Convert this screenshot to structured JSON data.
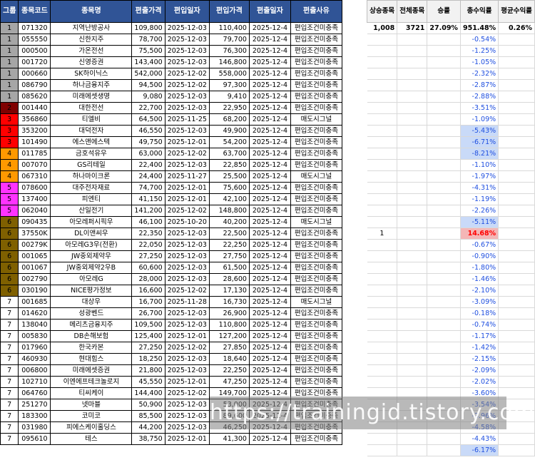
{
  "headers": {
    "group": "그룹",
    "code": "종목코드",
    "name": "종목명",
    "in_price": "편출가격",
    "in_date": "편입일자",
    "buy_price": "편입가격",
    "out_date": "편출일자",
    "reason": "편출사유"
  },
  "stats_headers": {
    "up": "상승종목",
    "total": "전체종목",
    "winrate": "승률",
    "total_return": "총수익률",
    "avg_return": "평균수익률"
  },
  "stats_values": {
    "up": "1,008",
    "total": "3721",
    "winrate": "27.09%",
    "total_return": "951.48%",
    "avg_return": "0.26%"
  },
  "group_colors": {
    "1": "#a6a6a6",
    "2": "#7f0000",
    "3": "#ff0000",
    "4": "#ff9900",
    "5": "#ff33ff",
    "6": "#7f6000",
    "7": "#ffffff"
  },
  "return_colors": {
    "neg": "#1f4fe0",
    "pos": "#ff0000",
    "highlight_blue": "#c9daf8",
    "highlight_red": "#f4b6b6"
  },
  "rows": [
    {
      "group": "1",
      "code": "071320",
      "name": "지역난방공사",
      "in_price": "109,800",
      "in_date": "2025-12-03",
      "buy_price": "110,400",
      "out_date": "2025-12-4",
      "reason": "편입조건미충족",
      "up": "",
      "ret": "-0.54%",
      "hl": ""
    },
    {
      "group": "1",
      "code": "055550",
      "name": "신한지주",
      "in_price": "78,700",
      "in_date": "2025-12-03",
      "buy_price": "79,700",
      "out_date": "2025-12-4",
      "reason": "편입조건미충족",
      "up": "",
      "ret": "-1.25%",
      "hl": ""
    },
    {
      "group": "1",
      "code": "000500",
      "name": "가온전선",
      "in_price": "75,500",
      "in_date": "2025-12-03",
      "buy_price": "76,300",
      "out_date": "2025-12-4",
      "reason": "편입조건미충족",
      "up": "",
      "ret": "-1.05%",
      "hl": ""
    },
    {
      "group": "1",
      "code": "001720",
      "name": "신영증권",
      "in_price": "143,400",
      "in_date": "2025-12-03",
      "buy_price": "146,800",
      "out_date": "2025-12-4",
      "reason": "편입조건미충족",
      "up": "",
      "ret": "-2.32%",
      "hl": ""
    },
    {
      "group": "1",
      "code": "000660",
      "name": "SK하이닉스",
      "in_price": "542,000",
      "in_date": "2025-12-02",
      "buy_price": "558,000",
      "out_date": "2025-12-4",
      "reason": "편입조건미충족",
      "up": "",
      "ret": "-2.87%",
      "hl": ""
    },
    {
      "group": "1",
      "code": "086790",
      "name": "하나금융지주",
      "in_price": "94,500",
      "in_date": "2025-12-02",
      "buy_price": "97,300",
      "out_date": "2025-12-4",
      "reason": "편입조건미충족",
      "up": "",
      "ret": "-2.88%",
      "hl": ""
    },
    {
      "group": "1",
      "code": "085620",
      "name": "미래에셋생명",
      "in_price": "9,080",
      "in_date": "2025-12-03",
      "buy_price": "9,410",
      "out_date": "2025-12-4",
      "reason": "편입조건미충족",
      "up": "",
      "ret": "-3.51%",
      "hl": ""
    },
    {
      "group": "2",
      "code": "001440",
      "name": "대한전선",
      "in_price": "22,700",
      "in_date": "2025-12-03",
      "buy_price": "22,950",
      "out_date": "2025-12-4",
      "reason": "편입조건미충족",
      "up": "",
      "ret": "-1.09%",
      "hl": ""
    },
    {
      "group": "3",
      "code": "356860",
      "name": "티엘비",
      "in_price": "64,500",
      "in_date": "2025-11-25",
      "buy_price": "68,200",
      "out_date": "2025-12-4",
      "reason": "매도시그널",
      "up": "",
      "ret": "-5.43%",
      "hl": "blue"
    },
    {
      "group": "3",
      "code": "353200",
      "name": "대덕전자",
      "in_price": "46,550",
      "in_date": "2025-12-03",
      "buy_price": "49,900",
      "out_date": "2025-12-4",
      "reason": "편입조건미충족",
      "up": "",
      "ret": "-6.71%",
      "hl": "blue"
    },
    {
      "group": "3",
      "code": "101490",
      "name": "에스앤에스텍",
      "in_price": "49,750",
      "in_date": "2025-12-01",
      "buy_price": "54,200",
      "out_date": "2025-12-4",
      "reason": "편입조건미충족",
      "up": "",
      "ret": "-8.21%",
      "hl": "blue"
    },
    {
      "group": "4",
      "code": "011785",
      "name": "금호석유우",
      "in_price": "63,000",
      "in_date": "2025-12-02",
      "buy_price": "63,700",
      "out_date": "2025-12-4",
      "reason": "편입조건미충족",
      "up": "",
      "ret": "-1.10%",
      "hl": ""
    },
    {
      "group": "4",
      "code": "007070",
      "name": "GS리테일",
      "in_price": "22,400",
      "in_date": "2025-12-03",
      "buy_price": "22,850",
      "out_date": "2025-12-4",
      "reason": "편입조건미충족",
      "up": "",
      "ret": "-1.97%",
      "hl": ""
    },
    {
      "group": "4",
      "code": "067310",
      "name": "하나마이크론",
      "in_price": "24,400",
      "in_date": "2025-11-27",
      "buy_price": "25,500",
      "out_date": "2025-12-4",
      "reason": "매도시그널",
      "up": "",
      "ret": "-4.31%",
      "hl": ""
    },
    {
      "group": "5",
      "code": "078600",
      "name": "대주전자재료",
      "in_price": "74,700",
      "in_date": "2025-12-01",
      "buy_price": "75,600",
      "out_date": "2025-12-4",
      "reason": "편입조건미충족",
      "up": "",
      "ret": "-1.19%",
      "hl": ""
    },
    {
      "group": "5",
      "code": "137400",
      "name": "피엔티",
      "in_price": "41,150",
      "in_date": "2025-12-01",
      "buy_price": "42,100",
      "out_date": "2025-12-4",
      "reason": "편입조건미충족",
      "up": "",
      "ret": "-2.26%",
      "hl": ""
    },
    {
      "group": "5",
      "code": "062040",
      "name": "산일전기",
      "in_price": "141,200",
      "in_date": "2025-12-02",
      "buy_price": "148,800",
      "out_date": "2025-12-4",
      "reason": "편입조건미충족",
      "up": "",
      "ret": "-5.11%",
      "hl": "blue"
    },
    {
      "group": "6",
      "code": "090435",
      "name": "아모레퍼시픽우",
      "in_price": "46,100",
      "in_date": "2025-10-20",
      "buy_price": "40,200",
      "out_date": "2025-12-4",
      "reason": "매도시그널",
      "up": "1",
      "ret": "14.68%",
      "hl": "red"
    },
    {
      "group": "6",
      "code": "37550K",
      "name": "DL이앤씨우",
      "in_price": "22,350",
      "in_date": "2025-12-03",
      "buy_price": "22,500",
      "out_date": "2025-12-4",
      "reason": "편입조건미충족",
      "up": "",
      "ret": "-0.67%",
      "hl": ""
    },
    {
      "group": "6",
      "code": "00279K",
      "name": "아모레G3우(전환)",
      "in_price": "22,050",
      "in_date": "2025-12-03",
      "buy_price": "22,250",
      "out_date": "2025-12-4",
      "reason": "편입조건미충족",
      "up": "",
      "ret": "-0.90%",
      "hl": ""
    },
    {
      "group": "6",
      "code": "001065",
      "name": "JW중외제약우",
      "in_price": "27,250",
      "in_date": "2025-12-03",
      "buy_price": "27,750",
      "out_date": "2025-12-4",
      "reason": "편입조건미충족",
      "up": "",
      "ret": "-1.80%",
      "hl": ""
    },
    {
      "group": "6",
      "code": "001067",
      "name": "JW중외제약2우B",
      "in_price": "60,600",
      "in_date": "2025-12-03",
      "buy_price": "61,500",
      "out_date": "2025-12-4",
      "reason": "편입조건미충족",
      "up": "",
      "ret": "-1.46%",
      "hl": ""
    },
    {
      "group": "6",
      "code": "002790",
      "name": "아모레G",
      "in_price": "28,000",
      "in_date": "2025-12-03",
      "buy_price": "28,600",
      "out_date": "2025-12-4",
      "reason": "편입조건미충족",
      "up": "",
      "ret": "-2.10%",
      "hl": ""
    },
    {
      "group": "6",
      "code": "030190",
      "name": "NICE평가정보",
      "in_price": "16,600",
      "in_date": "2025-12-02",
      "buy_price": "17,130",
      "out_date": "2025-12-4",
      "reason": "편입조건미충족",
      "up": "",
      "ret": "-3.09%",
      "hl": ""
    },
    {
      "group": "7",
      "code": "001685",
      "name": "대상우",
      "in_price": "16,700",
      "in_date": "2025-11-28",
      "buy_price": "16,730",
      "out_date": "2025-12-4",
      "reason": "매도시그널",
      "up": "",
      "ret": "-0.18%",
      "hl": ""
    },
    {
      "group": "7",
      "code": "014620",
      "name": "성광벤드",
      "in_price": "26,700",
      "in_date": "2025-12-03",
      "buy_price": "26,900",
      "out_date": "2025-12-4",
      "reason": "편입조건미충족",
      "up": "",
      "ret": "-0.74%",
      "hl": ""
    },
    {
      "group": "7",
      "code": "138040",
      "name": "메리츠금융지주",
      "in_price": "109,500",
      "in_date": "2025-12-03",
      "buy_price": "110,800",
      "out_date": "2025-12-4",
      "reason": "편입조건미충족",
      "up": "",
      "ret": "-1.17%",
      "hl": ""
    },
    {
      "group": "7",
      "code": "005830",
      "name": "DB손해보험",
      "in_price": "125,400",
      "in_date": "2025-12-01",
      "buy_price": "127,200",
      "out_date": "2025-12-4",
      "reason": "편입조건미충족",
      "up": "",
      "ret": "-1.42%",
      "hl": ""
    },
    {
      "group": "7",
      "code": "017960",
      "name": "한국카본",
      "in_price": "27,250",
      "in_date": "2025-12-02",
      "buy_price": "27,850",
      "out_date": "2025-12-4",
      "reason": "편입조건미충족",
      "up": "",
      "ret": "-2.15%",
      "hl": ""
    },
    {
      "group": "7",
      "code": "460930",
      "name": "현대힘스",
      "in_price": "18,250",
      "in_date": "2025-12-03",
      "buy_price": "18,640",
      "out_date": "2025-12-4",
      "reason": "편입조건미충족",
      "up": "",
      "ret": "-2.09%",
      "hl": ""
    },
    {
      "group": "7",
      "code": "006800",
      "name": "미래에셋증권",
      "in_price": "21,800",
      "in_date": "2025-12-03",
      "buy_price": "22,250",
      "out_date": "2025-12-4",
      "reason": "편입조건미충족",
      "up": "",
      "ret": "-2.02%",
      "hl": ""
    },
    {
      "group": "7",
      "code": "102710",
      "name": "이엔에프테크놀로지",
      "in_price": "45,550",
      "in_date": "2025-12-01",
      "buy_price": "47,250",
      "out_date": "2025-12-4",
      "reason": "편입조건미충족",
      "up": "",
      "ret": "-3.60%",
      "hl": ""
    },
    {
      "group": "7",
      "code": "064760",
      "name": "티씨케이",
      "in_price": "144,400",
      "in_date": "2025-12-02",
      "buy_price": "149,700",
      "out_date": "2025-12-4",
      "reason": "편입조건미충족",
      "up": "",
      "ret": "-3.54%",
      "hl": ""
    },
    {
      "group": "7",
      "code": "251270",
      "name": "넷마블",
      "in_price": "50,900",
      "in_date": "2025-12-03",
      "buy_price": "53,000",
      "out_date": "2025-12-4",
      "reason": "편입조건미충족",
      "up": "",
      "ret": "-3.96%",
      "hl": ""
    },
    {
      "group": "7",
      "code": "183300",
      "name": "코미코",
      "in_price": "85,500",
      "in_date": "2025-12-03",
      "buy_price": "89,600",
      "out_date": "2025-12-4",
      "reason": "편입조건미충족",
      "up": "",
      "ret": "-4.58%",
      "hl": ""
    },
    {
      "group": "7",
      "code": "031980",
      "name": "피에스케이홀딩스",
      "in_price": "44,200",
      "in_date": "2025-12-03",
      "buy_price": "46,250",
      "out_date": "2025-12-4",
      "reason": "편입조건미충족",
      "up": "",
      "ret": "-4.43%",
      "hl": ""
    },
    {
      "group": "7",
      "code": "095610",
      "name": "테스",
      "in_price": "38,750",
      "in_date": "2025-12-01",
      "buy_price": "41,300",
      "out_date": "2025-12-4",
      "reason": "편입조건미충족",
      "up": "",
      "ret": "-6.17%",
      "hl": "blue"
    }
  ],
  "watermark": "https://trainingid.tistory.com"
}
